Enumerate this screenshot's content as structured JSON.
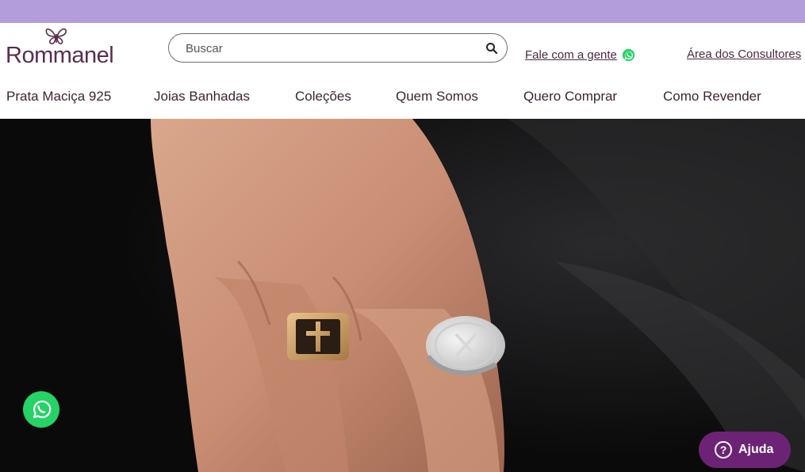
{
  "header": {
    "logo_text": "Rommanel",
    "search_placeholder": "Buscar",
    "contact_label": "Fale com a gente",
    "consultants_label": "Área dos Consultores"
  },
  "nav": {
    "items": [
      {
        "label": "Prata Maciça 925"
      },
      {
        "label": "Joias Banhadas"
      },
      {
        "label": "Coleções"
      },
      {
        "label": "Quem Somos"
      },
      {
        "label": "Quero Comprar"
      },
      {
        "label": "Como Revender"
      }
    ]
  },
  "help": {
    "label": "Ajuda"
  },
  "icons": {
    "logo": "butterfly-icon",
    "search": "search-icon",
    "contact": "whatsapp-icon",
    "floating": "whatsapp-icon",
    "help": "question-icon"
  },
  "colors": {
    "top_band": "#b39ddb",
    "brand_text": "#5a2d4f",
    "whatsapp": "#25d366",
    "help_button": "#6d2375"
  }
}
